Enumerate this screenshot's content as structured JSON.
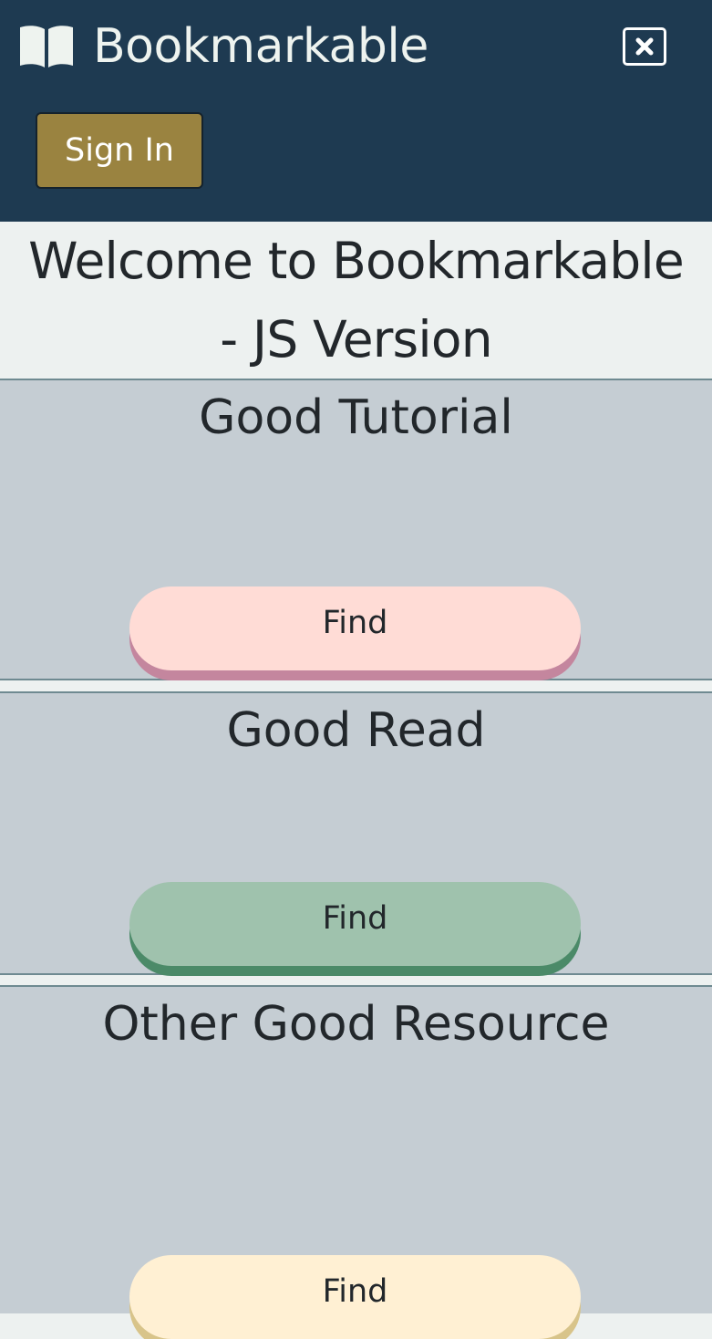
{
  "navbar": {
    "brand_icon": "open-book-icon",
    "brand_text": "Bookmarkable",
    "close_icon": "close-x-icon",
    "signin_label": "Sign In",
    "colors": {
      "background": "#1e3a51",
      "signin": "#9a8340"
    }
  },
  "welcome": {
    "line1": "Welcome to Bookmarkable",
    "line2": "- JS Version"
  },
  "cards": [
    {
      "title": "Good Tutorial",
      "button_label": "Find",
      "button_color": "#ffdcd6",
      "button_shadow": "#c4869e"
    },
    {
      "title": "Good Read",
      "button_label": "Find",
      "button_color": "#9fc2ad",
      "button_shadow": "#4b8a68"
    },
    {
      "title": "Other Good Resource",
      "button_label": "Find",
      "button_color": "#fff0d3",
      "button_shadow": "#d8c48a"
    }
  ]
}
